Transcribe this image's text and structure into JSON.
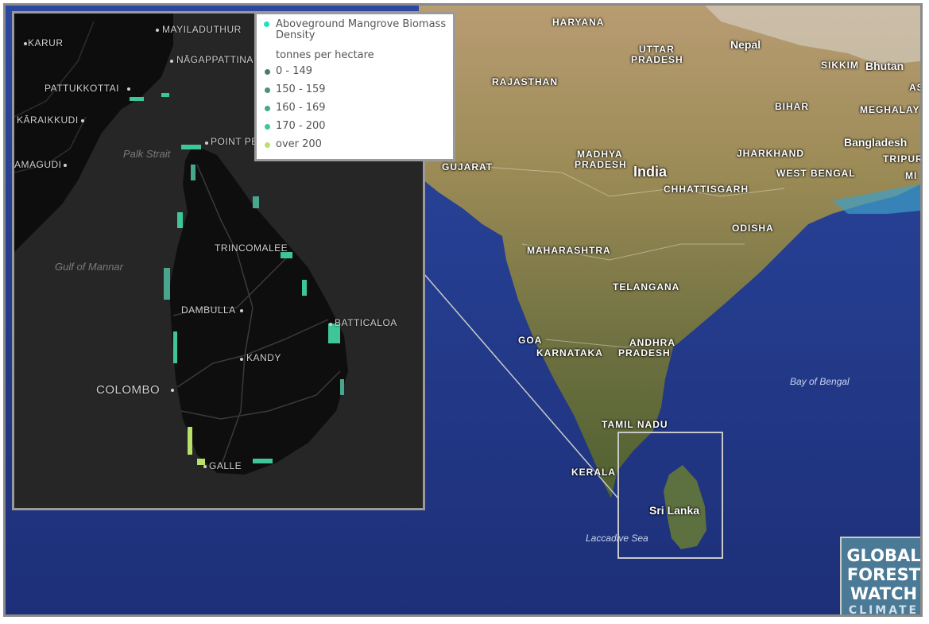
{
  "map": {
    "labels": {
      "haryana": "HARYANA",
      "nepal": "Nepal",
      "uttar_pradesh_1": "UTTAR",
      "uttar_pradesh_2": "PRADESH",
      "sikkim": "SIKKIM",
      "bhutan": "Bhutan",
      "rajasthan": "RAJASTHAN",
      "bihar": "BIHAR",
      "meghalaya": "MEGHALAY",
      "as": "AS",
      "bangladesh": "Bangladesh",
      "tripura": "TRIPUR",
      "mi": "MI",
      "madhya_pradesh_1": "MADHYA",
      "madhya_pradesh_2": "PRADESH",
      "jharkhand": "JHARKHAND",
      "gujarat": "GUJARAT",
      "india": "India",
      "west_bengal": "WEST BENGAL",
      "chhattisgarh": "CHHATTISGARH",
      "odisha": "ODISHA",
      "maharashtra": "MAHARASHTRA",
      "telangana": "TELANGANA",
      "goa": "GOA",
      "andhra_1": "ANDHRA",
      "andhra_2": "PRADESH",
      "karnataka": "KARNATAKA",
      "bay_of_bengal": "Bay of Bengal",
      "tamil_nadu": "TAMIL NADU",
      "kerala": "KERALA",
      "sri_lanka": "Sri Lanka",
      "laccadive_sea": "Laccadive Sea"
    }
  },
  "inset": {
    "labels": {
      "karur": "KARUR",
      "mayiladuthurai": "MAYILADUTHUR",
      "nagappattinam": "NĀGAPPATTINA",
      "pattukkottai": "PATTUKKOTTAI",
      "karaikkudi": "KĀRAIKKUDI",
      "palk_strait": "Palk Strait",
      "point_pedro": "POINT PE",
      "amagudi": "AMAGUDI",
      "gulf_of_mannar": "Gulf of Mannar",
      "trincomalee": "TRINCOMALEE",
      "dambulla": "DAMBULLA",
      "batticaloa": "BATTICALOA",
      "kandy": "KANDY",
      "colombo": "COLOMBO",
      "galle": "GALLE"
    }
  },
  "legend": {
    "title": "Aboveground Mangrove Biomass Density",
    "title_color": "#1fe0c0",
    "units": "tonnes per hectare",
    "items": [
      {
        "label": "0 - 149",
        "color": "#4d7a6b"
      },
      {
        "label": "150 - 159",
        "color": "#4f8d7e"
      },
      {
        "label": "160 - 169",
        "color": "#47a68d"
      },
      {
        "label": "170 - 200",
        "color": "#3fc59a"
      },
      {
        "label": "over 200",
        "color": "#b8e06a"
      }
    ]
  },
  "logo": {
    "line1": "GLOBAL",
    "line2": "FOREST",
    "line3": "WATCH",
    "line4": "CLIMATE"
  }
}
